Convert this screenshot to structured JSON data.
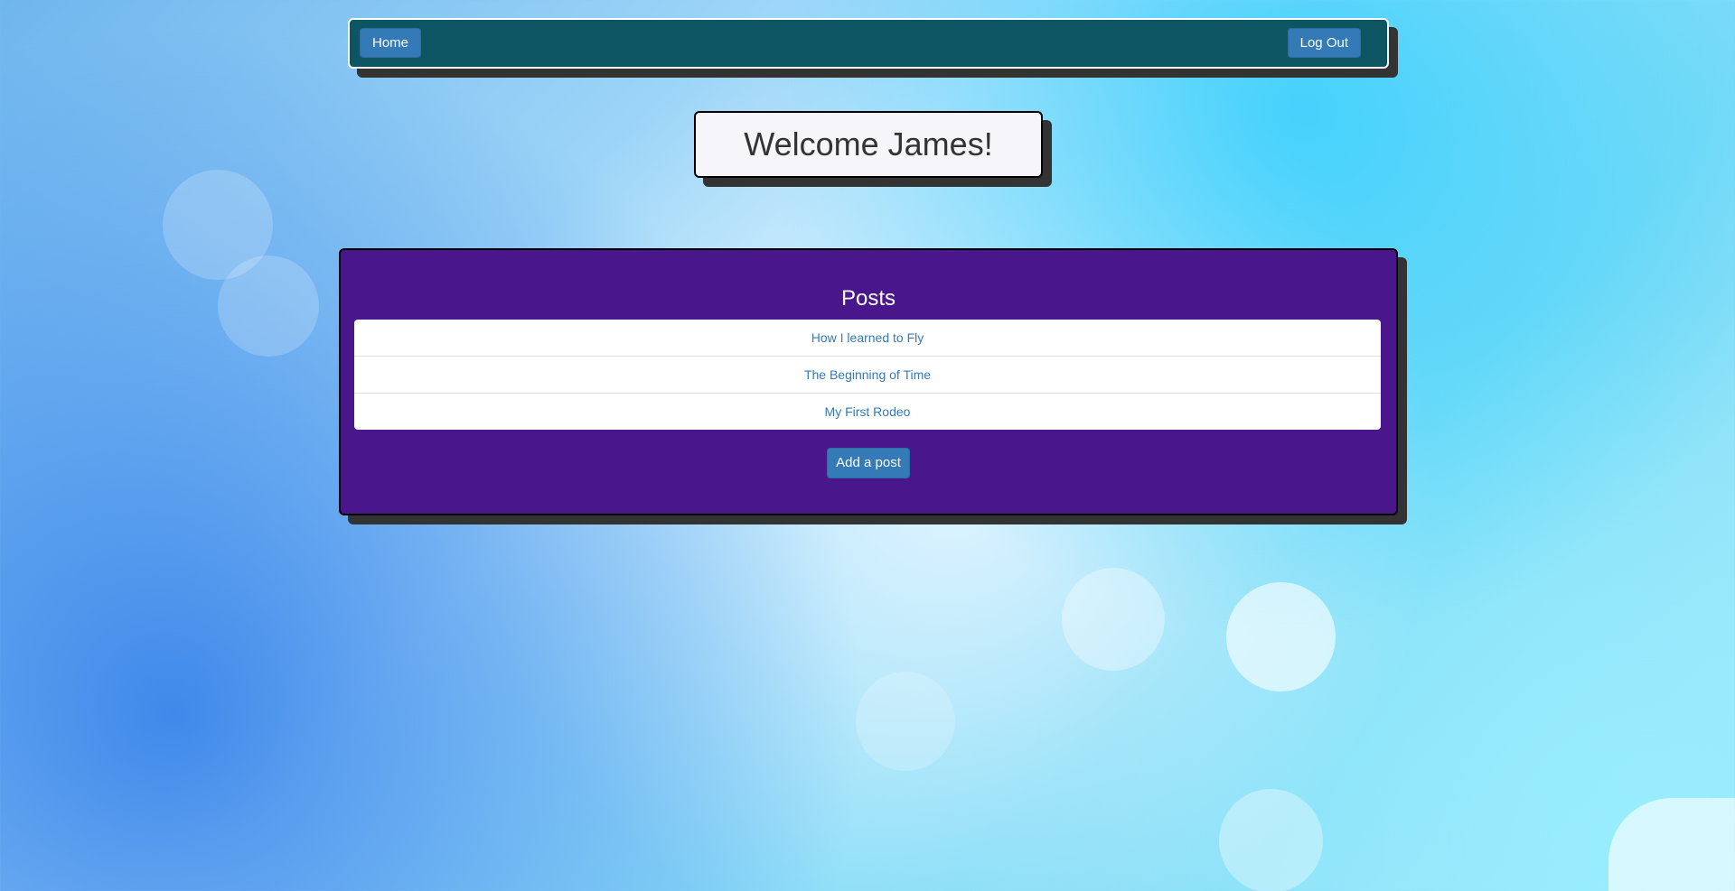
{
  "navbar": {
    "home_label": "Home",
    "logout_label": "Log Out"
  },
  "welcome": {
    "text": "Welcome James!"
  },
  "posts": {
    "title": "Posts",
    "items": [
      {
        "label": "How I learned to Fly"
      },
      {
        "label": "The Beginning of Time"
      },
      {
        "label": "My First Rodeo"
      }
    ],
    "add_label": "Add a post"
  },
  "colors": {
    "navbar_bg": "#0d5563",
    "panel_bg": "#4a168b",
    "button_bg": "#337ab7",
    "link": "#337ab7"
  }
}
